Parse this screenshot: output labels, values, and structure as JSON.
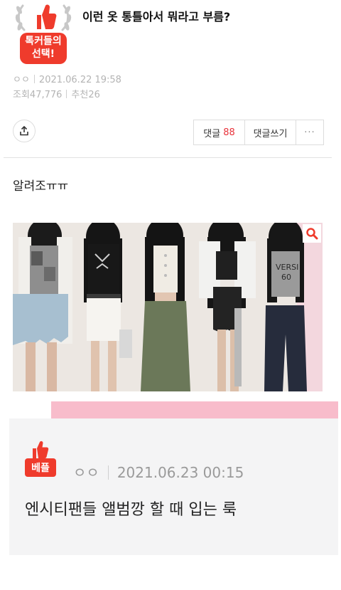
{
  "post": {
    "badge_line1": "톡커들의",
    "badge_line2": "선택!",
    "title": "이런 옷 통틀아서 뭐라고 부름?",
    "author": "ㅇㅇ",
    "datetime": "2021.06.22 19:58",
    "views": "조회47,776",
    "recommends": "추천26",
    "body": "알려조ㅠㅠ"
  },
  "actions": {
    "comments_label": "댓글",
    "comments_count": "88",
    "write_comment": "댓글쓰기",
    "more": "···"
  },
  "best_comment": {
    "label": "베플",
    "author": "ㅇㅇ",
    "datetime": "2021.06.23 00:15",
    "text": "엔시티팬들 앨범깡 할 때 입는 룩"
  },
  "colors": {
    "accent_red": "#ef3b2c",
    "pink_bar": "#f8bccb",
    "comment_bg": "#f4f4f5"
  },
  "icons": [
    "thumbs-up-icon",
    "laurel-icon",
    "share-icon",
    "search-icon"
  ]
}
